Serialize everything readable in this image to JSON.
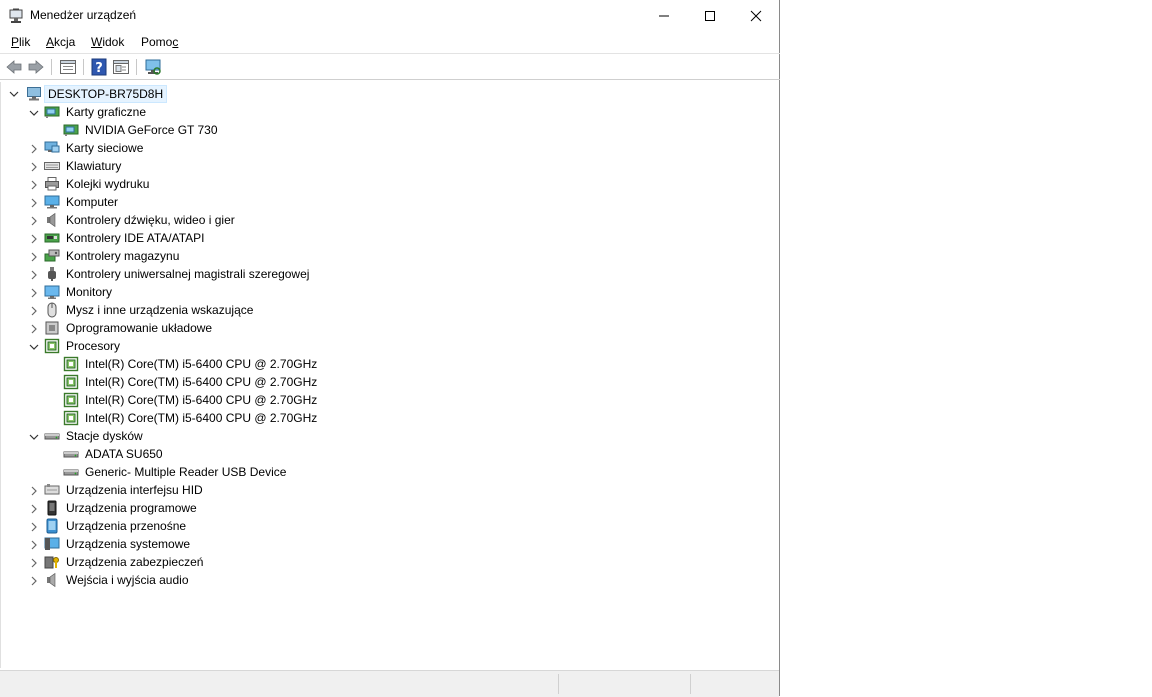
{
  "window": {
    "title": "Menedżer urządzeń"
  },
  "menu": [
    {
      "label_pre": "",
      "label_u": "P",
      "label_post": "lik"
    },
    {
      "label_pre": "",
      "label_u": "A",
      "label_post": "kcja"
    },
    {
      "label_pre": "",
      "label_u": "W",
      "label_post": "idok"
    },
    {
      "label_pre": "Pomo",
      "label_u": "c",
      "label_post": ""
    }
  ],
  "tree": {
    "root": "DESKTOP-BR75D8H",
    "items": [
      {
        "label": "Karty graficzne",
        "icon": "display-adapter-icon",
        "expanded": true
      },
      {
        "label": "NVIDIA GeForce GT 730",
        "icon": "display-adapter-icon",
        "child": true
      },
      {
        "label": "Karty sieciowe",
        "icon": "network-icon"
      },
      {
        "label": "Klawiatury",
        "icon": "keyboard-icon"
      },
      {
        "label": "Kolejki wydruku",
        "icon": "printer-icon"
      },
      {
        "label": "Komputer",
        "icon": "computer-icon"
      },
      {
        "label": "Kontrolery dźwięku, wideo i gier",
        "icon": "speaker-icon"
      },
      {
        "label": "Kontrolery IDE ATA/ATAPI",
        "icon": "ide-icon"
      },
      {
        "label": "Kontrolery magazynu",
        "icon": "storage-controller-icon"
      },
      {
        "label": "Kontrolery uniwersalnej magistrali szeregowej",
        "icon": "usb-icon"
      },
      {
        "label": "Monitory",
        "icon": "monitor-icon"
      },
      {
        "label": "Mysz i inne urządzenia wskazujące",
        "icon": "mouse-icon"
      },
      {
        "label": "Oprogramowanie układowe",
        "icon": "firmware-icon"
      },
      {
        "label": "Procesory",
        "icon": "cpu-icon",
        "expanded": true
      },
      {
        "label": "Intel(R) Core(TM) i5-6400 CPU @ 2.70GHz",
        "icon": "cpu-icon",
        "child": true
      },
      {
        "label": "Intel(R) Core(TM) i5-6400 CPU @ 2.70GHz",
        "icon": "cpu-icon",
        "child": true
      },
      {
        "label": "Intel(R) Core(TM) i5-6400 CPU @ 2.70GHz",
        "icon": "cpu-icon",
        "child": true
      },
      {
        "label": "Intel(R) Core(TM) i5-6400 CPU @ 2.70GHz",
        "icon": "cpu-icon",
        "child": true
      },
      {
        "label": "Stacje dysków",
        "icon": "disk-drive-icon",
        "expanded": true
      },
      {
        "label": "ADATA SU650",
        "icon": "disk-drive-icon",
        "child": true
      },
      {
        "label": "Generic- Multiple Reader USB Device",
        "icon": "disk-drive-icon",
        "child": true
      },
      {
        "label": "Urządzenia interfejsu HID",
        "icon": "hid-icon"
      },
      {
        "label": "Urządzenia programowe",
        "icon": "software-device-icon"
      },
      {
        "label": "Urządzenia przenośne",
        "icon": "portable-device-icon"
      },
      {
        "label": "Urządzenia systemowe",
        "icon": "system-device-icon"
      },
      {
        "label": "Urządzenia zabezpieczeń",
        "icon": "security-device-icon"
      },
      {
        "label": "Wejścia i wyjścia audio",
        "icon": "audio-io-icon"
      }
    ]
  },
  "colors": {
    "selection_bg": "#e5f3ff",
    "accent_blue": "#1e78c8",
    "cpu_green": "#3a7a2a"
  }
}
